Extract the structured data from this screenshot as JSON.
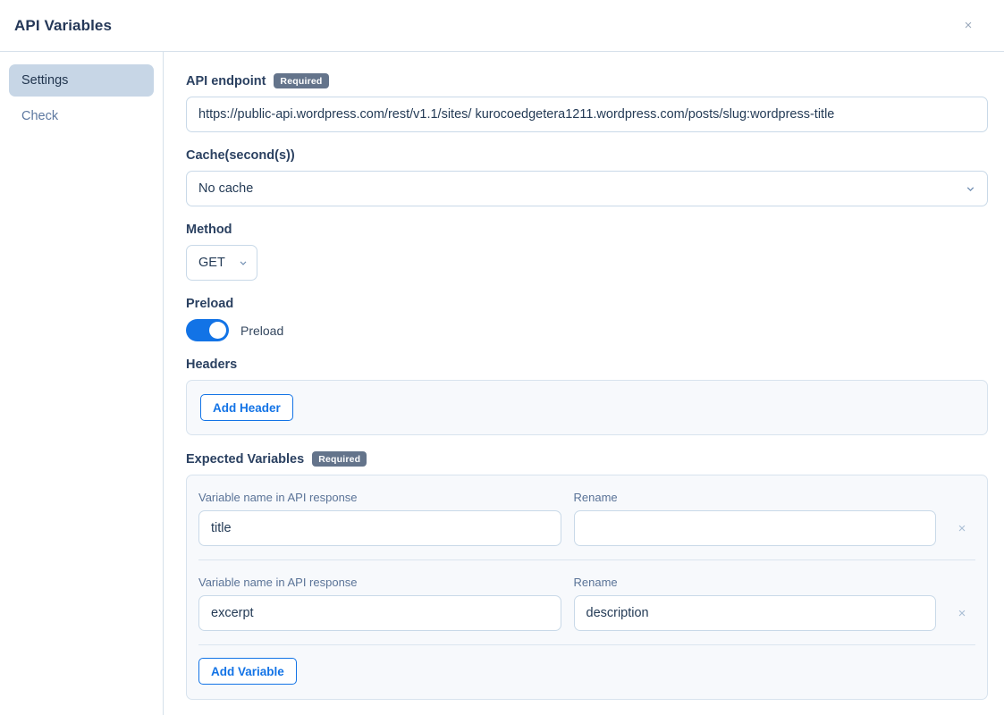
{
  "header": {
    "title": "API Variables",
    "close_label": "×"
  },
  "sidebar": {
    "items": [
      {
        "label": "Settings",
        "active": true
      },
      {
        "label": "Check",
        "active": false
      }
    ]
  },
  "main": {
    "badge_required": "Required",
    "api_endpoint": {
      "label": "API endpoint",
      "value": "https://public-api.wordpress.com/rest/v1.1/sites/ kurocoedgetera1211.wordpress.com/posts/slug:wordpress-title",
      "placeholder": ""
    },
    "cache": {
      "label": "Cache(second(s))",
      "value": "No cache",
      "options": [
        "No cache"
      ],
      "chevron_icon": "chevron-down-icon"
    },
    "method": {
      "label": "Method",
      "value": "GET",
      "options": [
        "GET"
      ],
      "chevron_icon": "chevron-down-icon"
    },
    "preload": {
      "label": "Preload",
      "toggle_label": "Preload",
      "enabled": true
    },
    "headers": {
      "label": "Headers",
      "add_button": "Add Header"
    },
    "expected_variables": {
      "label": "Expected Variables",
      "col_name_label": "Variable name in API response",
      "col_rename_label": "Rename",
      "remove_label": "×",
      "add_button": "Add Variable",
      "rows": [
        {
          "name": "title",
          "rename": "",
          "rename_placeholder": ""
        },
        {
          "name": "excerpt",
          "rename": "description",
          "rename_placeholder": ""
        }
      ]
    }
  }
}
